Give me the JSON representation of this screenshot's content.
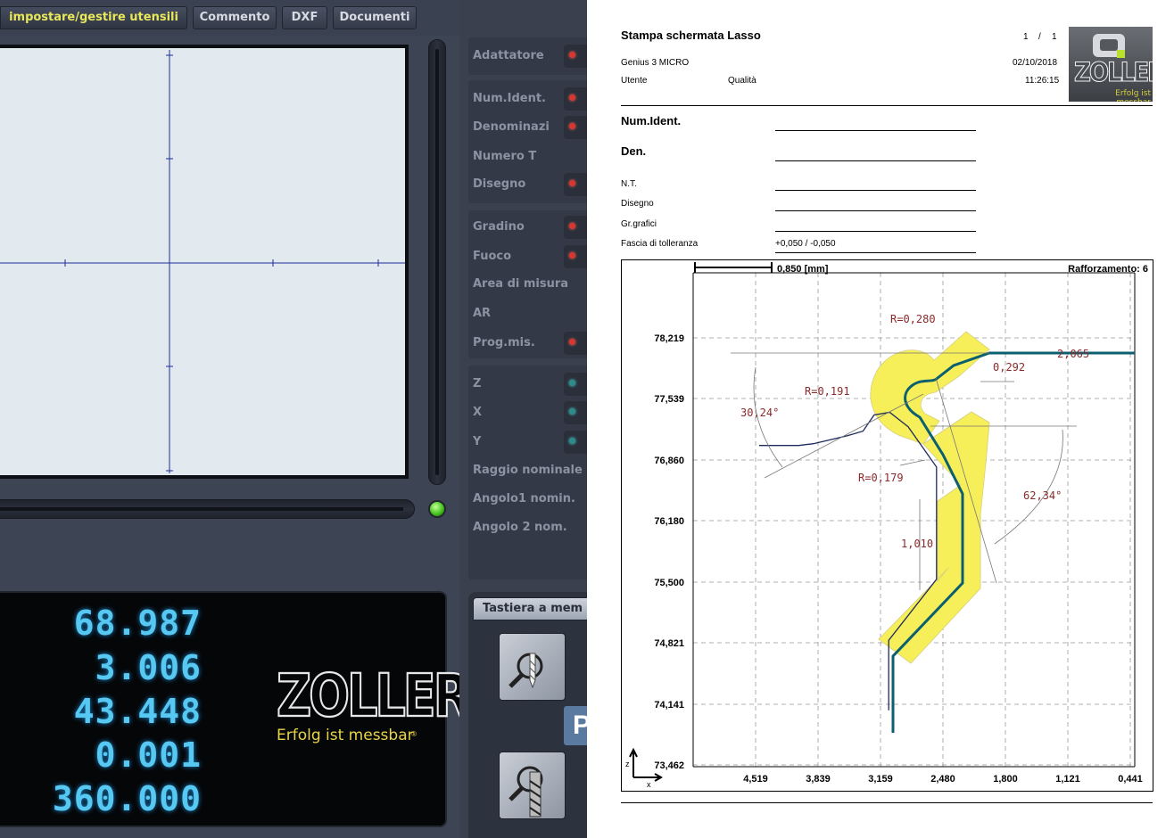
{
  "app": {
    "tabs": [
      "impostare/gestire utensili",
      "Commento",
      "DXF",
      "Documenti"
    ],
    "params": {
      "group1": [
        "Adattatore"
      ],
      "group2": [
        "Num.Ident.",
        "Denominazi",
        "Numero T",
        "Disegno"
      ],
      "group3": [
        "Gradino",
        "Fuoco",
        "Area di misura",
        "AR",
        "Prog.mis."
      ],
      "group4": [
        "Z",
        "X",
        "Y",
        "Raggio nominale",
        "Angolo1 nomin.",
        "Angolo 2 nom."
      ]
    },
    "readout": [
      "68.987",
      "3.006",
      "43.448",
      "0.001",
      "360.000"
    ],
    "logo": {
      "wordmark": "ZOLLER",
      "tagline": "Erfolg ist messbar",
      "reg": "®"
    },
    "keyboard_tab": "Tastiera a mem",
    "p_button": "P",
    "colors": {
      "readout": "#56c8f2",
      "panel": "#3d4454",
      "active_tab_text": "#e8e85a"
    },
    "icons": [
      "magnifier-drill-icon",
      "magnifier-endmill-icon",
      "status-led-icon"
    ]
  },
  "report": {
    "title": "Stampa schermata Lasso",
    "page": "1",
    "page_sep": "/",
    "page_total": "1",
    "machine": "Genius 3 MICRO",
    "date": "02/10/2018",
    "user_label": "Utente",
    "user_value": "Qualità",
    "time": "11:26:15",
    "fields": [
      {
        "label": "Num.Ident.",
        "value": ""
      },
      {
        "label": "Den.",
        "value": ""
      },
      {
        "label": "N.T.",
        "value": ""
      },
      {
        "label": "Disegno",
        "value": ""
      },
      {
        "label": "Gr.grafici",
        "value": ""
      },
      {
        "label": "Fascia di tolleranza",
        "value": "+0,050 / -0,050"
      }
    ],
    "logo": {
      "wordmark": "ZOLLER",
      "tagline": "Erfolg ist messbar"
    }
  },
  "chart_data": {
    "type": "line",
    "scale_bar": "0,850 [mm]",
    "enhancement": "Rafforzamento: 6",
    "x_ticks": [
      "4,519",
      "3,839",
      "3,159",
      "2,480",
      "1,800",
      "1,121",
      "0,441"
    ],
    "y_ticks": [
      "78,219",
      "77,539",
      "76,860",
      "76,180",
      "75,500",
      "74,821",
      "74,141",
      "73,462"
    ],
    "axis_labels": {
      "z": "z",
      "x": "x"
    },
    "annotations": [
      "R=0,280",
      "R=0,191",
      "R=0,179",
      "0,292",
      "2,065",
      "30,24°",
      "62,34°",
      "1,010"
    ],
    "grid": true,
    "colors": {
      "tolerance_band": "#f6ef5a",
      "profile": "#0b5f6e",
      "nominal": "#1e2a5c",
      "annotation": "#8a2a2a"
    },
    "profile": {
      "nominal": [
        [
          3.07,
          74.07
        ],
        [
          3.07,
          74.85
        ],
        [
          2.55,
          75.53
        ],
        [
          2.55,
          76.78
        ],
        [
          2.86,
          77.23
        ],
        [
          3.06,
          77.39
        ],
        [
          3.23,
          77.36
        ],
        [
          3.35,
          77.18
        ],
        [
          3.52,
          77.13
        ],
        [
          3.89,
          77.04
        ],
        [
          4.05,
          77.02
        ],
        [
          4.48,
          77.02
        ]
      ]
    }
  }
}
